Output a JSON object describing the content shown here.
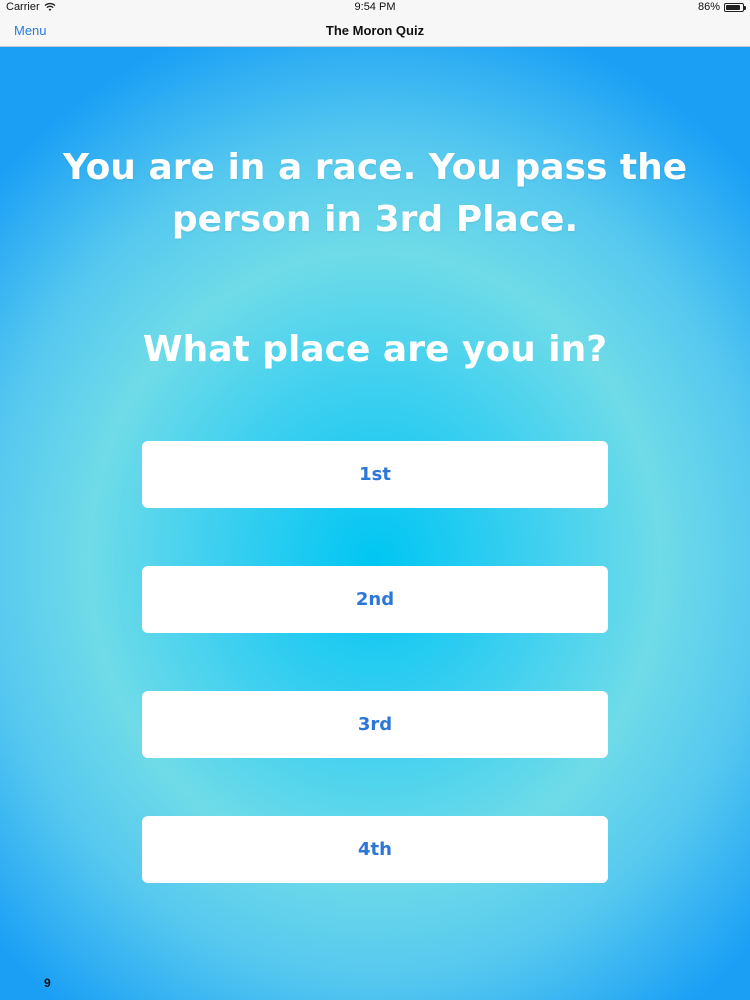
{
  "status_bar": {
    "carrier": "Carrier",
    "time": "9:54 PM",
    "battery": "86%",
    "battery_level": 0.86
  },
  "nav": {
    "menu_label": "Menu",
    "title": "The Moron Quiz"
  },
  "question": {
    "text": "You are in a race. You pass the person in 3rd Place.",
    "prompt": "What place are you in?"
  },
  "answers": [
    {
      "label": "1st"
    },
    {
      "label": "2nd"
    },
    {
      "label": "3rd"
    },
    {
      "label": "4th"
    }
  ],
  "question_number": "9",
  "colors": {
    "accent": "#2a7ae2",
    "button_text": "#2a77d8",
    "background_center": "#00c6f2",
    "background_edge": "#1a9ff5"
  }
}
